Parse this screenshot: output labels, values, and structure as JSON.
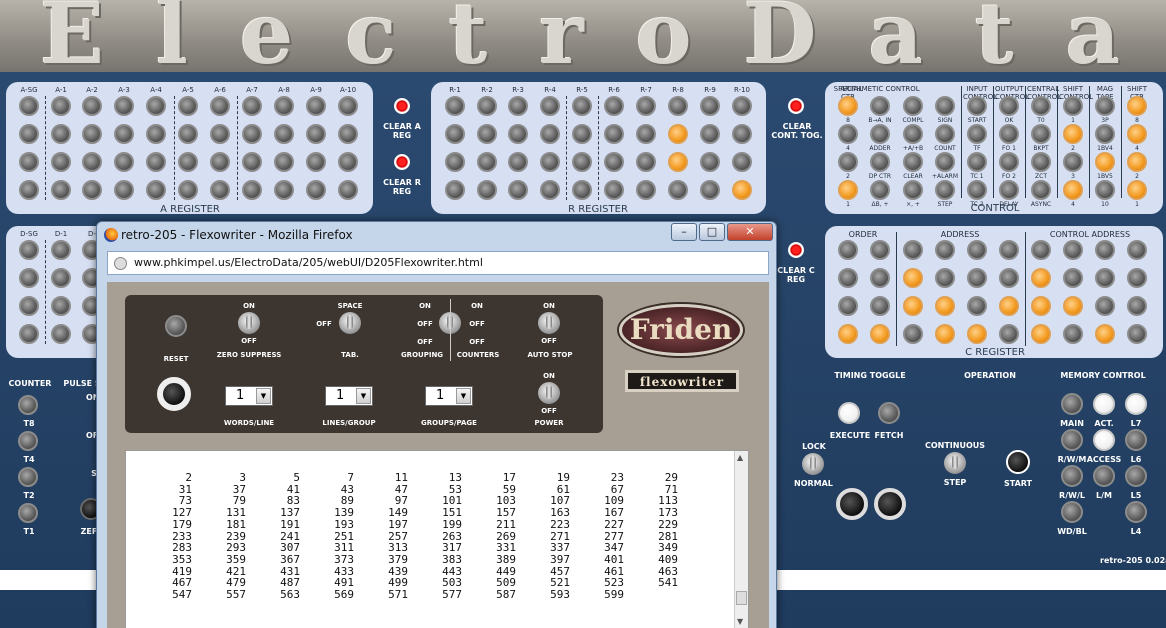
{
  "banner": {
    "title": "ElectroData"
  },
  "a_register": {
    "columns": [
      "A-SG",
      "A-1",
      "A-2",
      "A-3",
      "A-4",
      "A-5",
      "A-6",
      "A-7",
      "A-8",
      "A-9",
      "A-10"
    ],
    "title": "A REGISTER",
    "clear_label": "CLEAR A REG"
  },
  "r_register": {
    "columns": [
      "R-1",
      "R-2",
      "R-3",
      "R-4",
      "R-5",
      "R-6",
      "R-7",
      "R-8",
      "R-9",
      "R-10"
    ],
    "title": "R REGISTER",
    "clear_label": "CLEAR R REG",
    "lit": [
      [
        8,
        1
      ],
      [
        8,
        2
      ],
      [
        10,
        3
      ]
    ]
  },
  "d_register": {
    "columns": [
      "D-SG",
      "D-1",
      "D-"
    ]
  },
  "clear_cont_tog": "CLEAR CONT. TOG.",
  "clear_c_reg": "CLEAR C REG",
  "control_panel": {
    "title": "CONTROL",
    "headers": [
      "SPECIAL CTR",
      "ARITHMETIC CONTROL",
      "INPUT CONTROL",
      "OUTPUT CONTROL",
      "CENTRAL CONTROL",
      "SHIFT CONTROL",
      "MAG TAPE",
      "SHIFT CTR"
    ],
    "row1": [
      "8",
      "B→A, IN",
      "COMPL",
      "SIGN",
      "START",
      "OK",
      "T0",
      "1",
      "3P",
      "8"
    ],
    "row2": [
      "4",
      "ADDER",
      "+A/+B",
      "COUNT",
      "TF",
      "FO 1",
      "BKPT",
      "2",
      "1BV4",
      "4"
    ],
    "row3": [
      "2",
      "DP CTR",
      "CLEAR",
      "+ALARM",
      "TC 1",
      "FO 2",
      "ZCT",
      "3",
      "1BV5",
      "2"
    ],
    "row4": [
      "1",
      "ΔB, +",
      "×, +",
      "STEP",
      "TC 2",
      "DELAY",
      "ASYNC",
      "4",
      "10",
      "1"
    ]
  },
  "c_register": {
    "title": "C REGISTER",
    "groups": [
      "ORDER",
      "ADDRESS",
      "CONTROL ADDRESS"
    ]
  },
  "left_section": {
    "counter": "COUNTER",
    "pulse": "PULSE S",
    "labels": [
      "T8",
      "T4",
      "T2",
      "T1"
    ],
    "partial": [
      "ON",
      "OF",
      "S",
      "ZEF"
    ]
  },
  "right_section": {
    "timing_toggle": "TIMING TOGGLE",
    "operation": "OPERATION",
    "memory_control": "MEMORY CONTROL",
    "execute": "EXECUTE",
    "fetch": "FETCH",
    "lock": "LOCK",
    "normal": "NORMAL",
    "continuous": "CONTINUOUS",
    "step": "STEP",
    "start": "START",
    "mem_labels": [
      "MAIN",
      "ACT.",
      "L7",
      "R/W/M",
      "ACCESS",
      "L6",
      "R/W/L",
      "L/M",
      "L5",
      "WD/BL",
      "L4"
    ],
    "version": "retro-205 0.02a"
  },
  "firefox": {
    "window_title": "retro-205 - Flexowriter - Mozilla Firefox",
    "url": "www.phkimpel.us/ElectroData/205/webUI/D205Flexowriter.html",
    "minimize": "–",
    "maximize": "□",
    "close": "✕"
  },
  "flexowriter": {
    "reset": "RESET",
    "zero_suppress": {
      "on": "ON",
      "off": "OFF",
      "label": "ZERO SUPPRESS"
    },
    "tab": {
      "space": "SPACE",
      "off": "OFF",
      "label": "TAB."
    },
    "grouping": {
      "on": "ON",
      "off": "OFF",
      "label": "GROUPING"
    },
    "counters": {
      "on": "ON",
      "off": "OFF",
      "label": "COUNTERS"
    },
    "auto_stop": {
      "on": "ON",
      "off": "OFF",
      "label": "AUTO STOP"
    },
    "power": {
      "on": "ON",
      "off": "OFF",
      "label": "POWER"
    },
    "words_line": {
      "value": "1",
      "label": "WORDS/LINE"
    },
    "lines_group": {
      "value": "1",
      "label": "LINES/GROUP"
    },
    "groups_page": {
      "value": "1",
      "label": "GROUPS/PAGE"
    },
    "brand": "Friden",
    "model": "flexowriter"
  },
  "paper": {
    "rows": [
      [
        "2",
        "3",
        "5",
        "7",
        "11",
        "13",
        "17",
        "19",
        "23",
        "29"
      ],
      [
        "31",
        "37",
        "41",
        "43",
        "47",
        "53",
        "59",
        "61",
        "67",
        "71"
      ],
      [
        "73",
        "79",
        "83",
        "89",
        "97",
        "101",
        "103",
        "107",
        "109",
        "113"
      ],
      [
        "127",
        "131",
        "137",
        "139",
        "149",
        "151",
        "157",
        "163",
        "167",
        "173"
      ],
      [
        "179",
        "181",
        "191",
        "193",
        "197",
        "199",
        "211",
        "223",
        "227",
        "229"
      ],
      [
        "233",
        "239",
        "241",
        "251",
        "257",
        "263",
        "269",
        "271",
        "277",
        "281"
      ],
      [
        "283",
        "293",
        "307",
        "311",
        "313",
        "317",
        "331",
        "337",
        "347",
        "349"
      ],
      [
        "353",
        "359",
        "367",
        "373",
        "379",
        "383",
        "389",
        "397",
        "401",
        "409"
      ],
      [
        "419",
        "421",
        "431",
        "433",
        "439",
        "443",
        "449",
        "457",
        "461",
        "463"
      ],
      [
        "467",
        "479",
        "487",
        "491",
        "499",
        "503",
        "509",
        "521",
        "523",
        "541"
      ],
      [
        "547",
        "557",
        "563",
        "569",
        "571",
        "577",
        "587",
        "593",
        "599",
        ""
      ]
    ]
  }
}
